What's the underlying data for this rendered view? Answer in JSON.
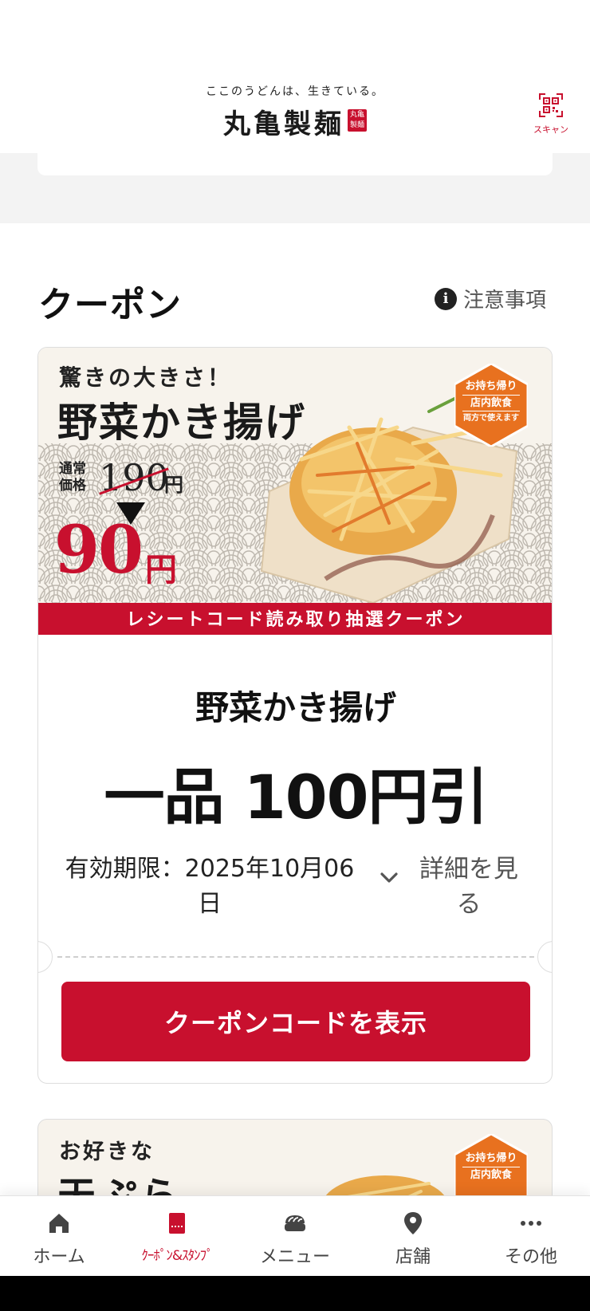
{
  "header": {
    "tagline": "ここのうどんは、生きている。",
    "brand": "丸亀製麺",
    "seal": "丸亀製麺",
    "scan_label": "スキャン"
  },
  "section": {
    "title": "クーポン",
    "notice_label": "注意事項"
  },
  "coupon": {
    "banner": {
      "catch": "驚きの大きさ！",
      "product": "野菜かき揚げ",
      "regular_label": "通常価格",
      "regular_price": "190",
      "regular_yen": "円",
      "sale_price": "90",
      "sale_yen": "円",
      "badge_line1": "お持ち帰り",
      "badge_line2": "店内飲食",
      "badge_line3": "両方で使えます",
      "ribbon": "レシートコード読み取り抽選クーポン"
    },
    "title": "野菜かき揚げ",
    "discount": "一品 100円引",
    "expiry": "有効期限：2025年10月06日",
    "details_label": "詳細を見る",
    "show_code_label": "クーポンコードを表示"
  },
  "coupon2": {
    "catch": "お好きな",
    "product": "天ぷら",
    "badge_line1": "お持ち帰り",
    "badge_line2": "店内飲食"
  },
  "tabbar": {
    "items": [
      {
        "label": "ホーム",
        "icon": "home-icon"
      },
      {
        "label": "ｸｰﾎﾟﾝ&ｽﾀﾝﾌﾟ",
        "icon": "coupon-icon"
      },
      {
        "label": "メニュー",
        "icon": "bowl-icon"
      },
      {
        "label": "店舗",
        "icon": "map-pin-icon"
      },
      {
        "label": "その他",
        "icon": "more-icon"
      }
    ],
    "active_index": 1
  },
  "colors": {
    "accent": "#c8102e",
    "badge": "#e8711f",
    "text": "#111111",
    "muted": "#555555"
  }
}
